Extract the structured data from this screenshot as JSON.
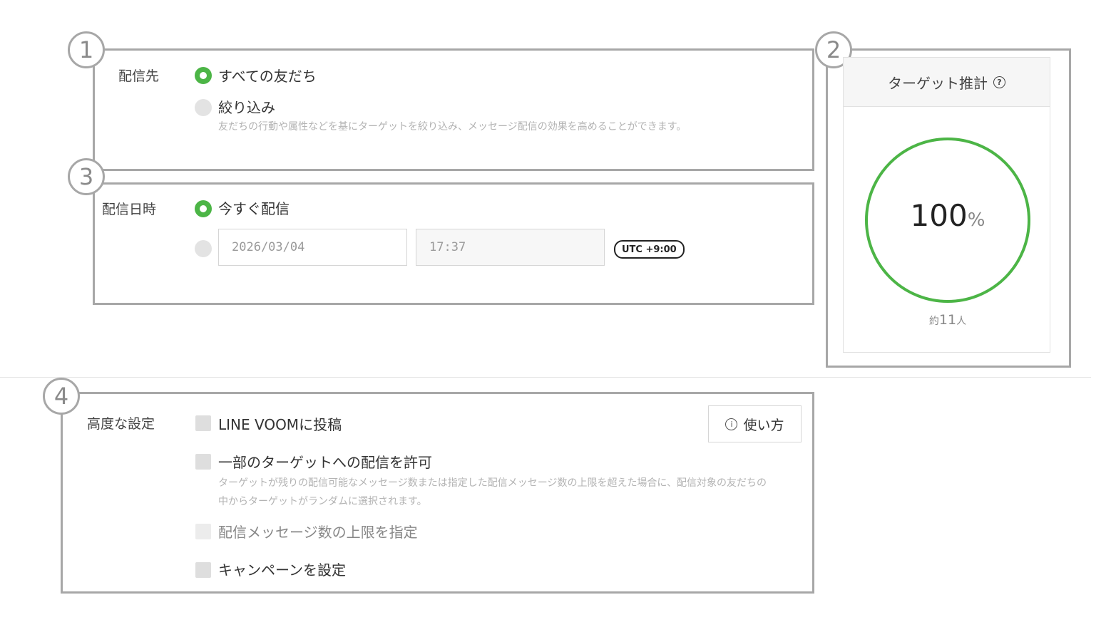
{
  "badges": {
    "one": "1",
    "two": "2",
    "three": "3",
    "four": "4"
  },
  "destination": {
    "label": "配信先",
    "all_friends": "すべての友だち",
    "narrow": "絞り込み",
    "narrow_desc": "友だちの行動や属性などを基にターゲットを絞り込み、メッセージ配信の効果を高めることができます。"
  },
  "datetime": {
    "label": "配信日時",
    "now": "今すぐ配信",
    "date_value": "2026/03/04",
    "time_value": "17:37",
    "timezone": "UTC +9:00"
  },
  "target": {
    "title": "ターゲット推計",
    "help_icon": "question-circle-icon",
    "percent_number": "100",
    "percent_unit": "%",
    "percent_fraction": 1.0,
    "count_prefix": "約",
    "count_number": "11",
    "count_suffix": "人"
  },
  "advanced": {
    "label": "高度な設定",
    "howto_button": "使い方",
    "howto_icon": "info-circle-icon",
    "line_voom": "LINE VOOMに投稿",
    "partial": "一部のターゲットへの配信を許可",
    "partial_desc": "ターゲットが残りの配信可能なメッセージ数または指定した配信メッセージ数の上限を超えた場合に、配信対象の友だちの中からターゲットがランダムに選択されます。",
    "limit": "配信メッセージ数の上限を指定",
    "campaign": "キャンペーンを設定"
  },
  "colors": {
    "accent_green": "#4cb546",
    "frame_gray": "#a7a7a7"
  }
}
